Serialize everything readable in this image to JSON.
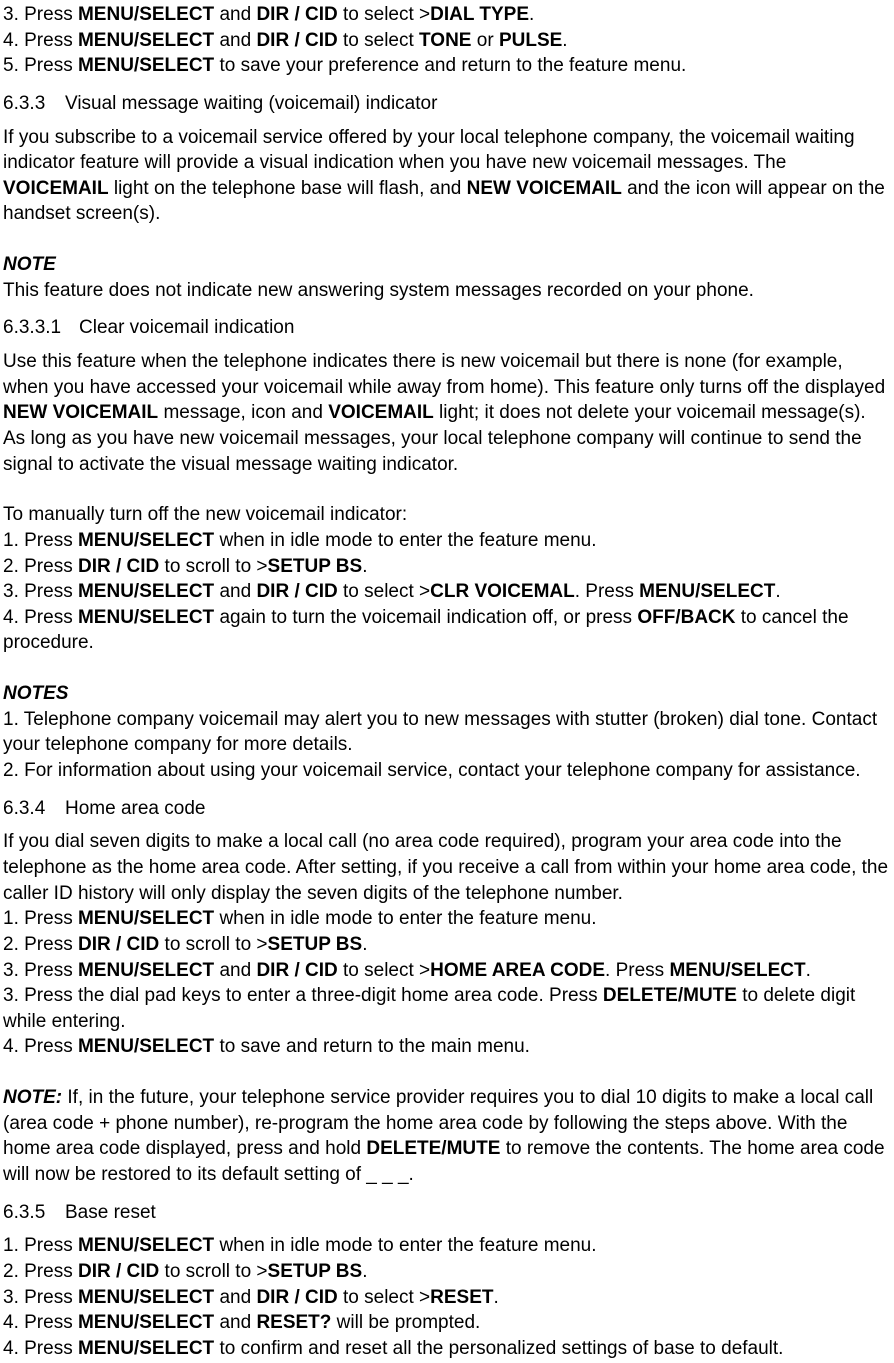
{
  "s0": {
    "l3": "3. Press ",
    "b3a": "MENU/SELECT",
    "t3b": " and ",
    "b3c": "DIR / CID",
    "t3d": " to select >",
    "b3e": "DIAL TYPE",
    "t3f": ".",
    "l4": "4. Press ",
    "b4a": "MENU/SELECT",
    "t4b": " and ",
    "b4c": "DIR / CID",
    "t4d": " to select ",
    "b4e": "TONE",
    "t4f": " or ",
    "b4g": "PULSE",
    "t4h": ".",
    "l5": "5. Press ",
    "b5a": "MENU/SELECT",
    "t5b": " to save your preference and return to the feature menu."
  },
  "s633": {
    "num": "6.3.3",
    "title": "Visual message waiting (voicemail) indicator",
    "p1a": "If you subscribe to a voicemail service offered by your local telephone company, the voicemail waiting indicator feature will provide a visual indication when you have new voicemail messages. The ",
    "p1b": "VOICEMAIL",
    "p1c": " light on the telephone base will flash, and ",
    "p1d": "NEW VOICEMAIL",
    "p1e": " and the icon will appear on the handset screen(s).",
    "note_label": "NOTE",
    "note_text": "This feature does not indicate new answering system messages recorded on your phone."
  },
  "s6331": {
    "num": "6.3.3.1",
    "title": "Clear voicemail indication",
    "p1a": "Use this feature when the telephone indicates there is new voicemail but there is none (for example, when you have accessed your voicemail while away from home). This feature only turns off the displayed ",
    "p1b": "NEW VOICEMAIL",
    "p1c": " message, icon and ",
    "p1d": "VOICEMAIL",
    "p1e": " light; it does not delete your voicemail message(s). As long as you have new voicemail messages, your local telephone company will continue to send the signal to activate the visual message waiting indicator.",
    "intro": "To manually turn off the new voicemail indicator:",
    "l1": "1. Press ",
    "b1a": "MENU/SELECT",
    "t1b": " when in idle mode to enter the feature menu.",
    "l2": "2. Press ",
    "b2a": "DIR / CID",
    "t2b": " to scroll to >",
    "b2c": "SETUP BS",
    "t2d": ".",
    "l3": "3. Press ",
    "b3a": "MENU/SELECT",
    "t3b": " and ",
    "b3c": "DIR / CID",
    "t3d": " to select >",
    "b3e": "CLR VOICEMAL",
    "t3f": ". Press ",
    "b3g": "MENU/SELECT",
    "t3h": ".",
    "l4": "4. Press ",
    "b4a": "MENU/SELECT",
    "t4b": " again to turn the voicemail indication off, or press ",
    "b4c": "OFF/BACK",
    "t4d": " to cancel the procedure.",
    "notes_label": "NOTES",
    "n1": "1. Telephone company voicemail may alert you to new messages with stutter (broken) dial tone. Contact your telephone company for more details.",
    "n2": "2. For information about using your voicemail service, contact your telephone company for assistance."
  },
  "s634": {
    "num": "6.3.4",
    "title": "Home area code",
    "p1": "If you dial seven digits to make a local call (no area code required), program your area code into the telephone as the home area code. After setting, if you receive a call from within your home area code, the caller ID history will only display the seven digits of the telephone number.",
    "l1": "1. Press ",
    "b1a": "MENU/SELECT",
    "t1b": " when in idle mode to enter the feature menu.",
    "l2": "2. Press ",
    "b2a": "DIR / CID",
    "t2b": " to scroll to >",
    "b2c": "SETUP BS",
    "t2d": ".",
    "l3a": "3. Press ",
    "b3a": "MENU/SELECT",
    "t3b": " and ",
    "b3c": "DIR / CID",
    "t3d": " to select >",
    "b3e": "HOME AREA CODE",
    "t3f": ". Press ",
    "b3g": "MENU/SELECT",
    "t3h": ".",
    "l3x": "3. Press the dial pad keys to enter a three-digit home area code. Press ",
    "b3xa": "DELETE/MUTE",
    "t3xb": " to delete digit while entering.",
    "l4": "4. Press ",
    "b4a": "MENU/SELECT",
    "t4b": " to save and return to the main menu.",
    "note_label": "NOTE:",
    "note_a": " If, in the future, your telephone service provider requires you to dial 10 digits to make a local call (area code + phone number), re-program the home area code by following the steps above. With the home area code displayed, press and hold ",
    "note_b": "DELETE/MUTE",
    "note_c": " to remove the contents. The home area code will now be restored to its default setting of _ _ _."
  },
  "s635": {
    "num": "6.3.5",
    "title": "Base reset",
    "l1": "1. Press ",
    "b1a": "MENU/SELECT",
    "t1b": " when in idle mode to enter the feature menu.",
    "l2": "2. Press ",
    "b2a": "DIR / CID",
    "t2b": " to scroll to >",
    "b2c": "SETUP BS",
    "t2d": ".",
    "l3": "3. Press ",
    "b3a": "MENU/SELECT",
    "t3b": " and ",
    "b3c": "DIR / CID",
    "t3d": " to select >",
    "b3e": "RESET",
    "t3f": ".",
    "l4": "4. Press ",
    "b4a": "MENU/SELECT",
    "t4b": " and ",
    "b4c": "RESET?",
    "t4d": " will be prompted.",
    "l5": "4. Press ",
    "b5a": "MENU/SELECT",
    "t5b": " to confirm and reset all the personalized settings of base to default."
  }
}
